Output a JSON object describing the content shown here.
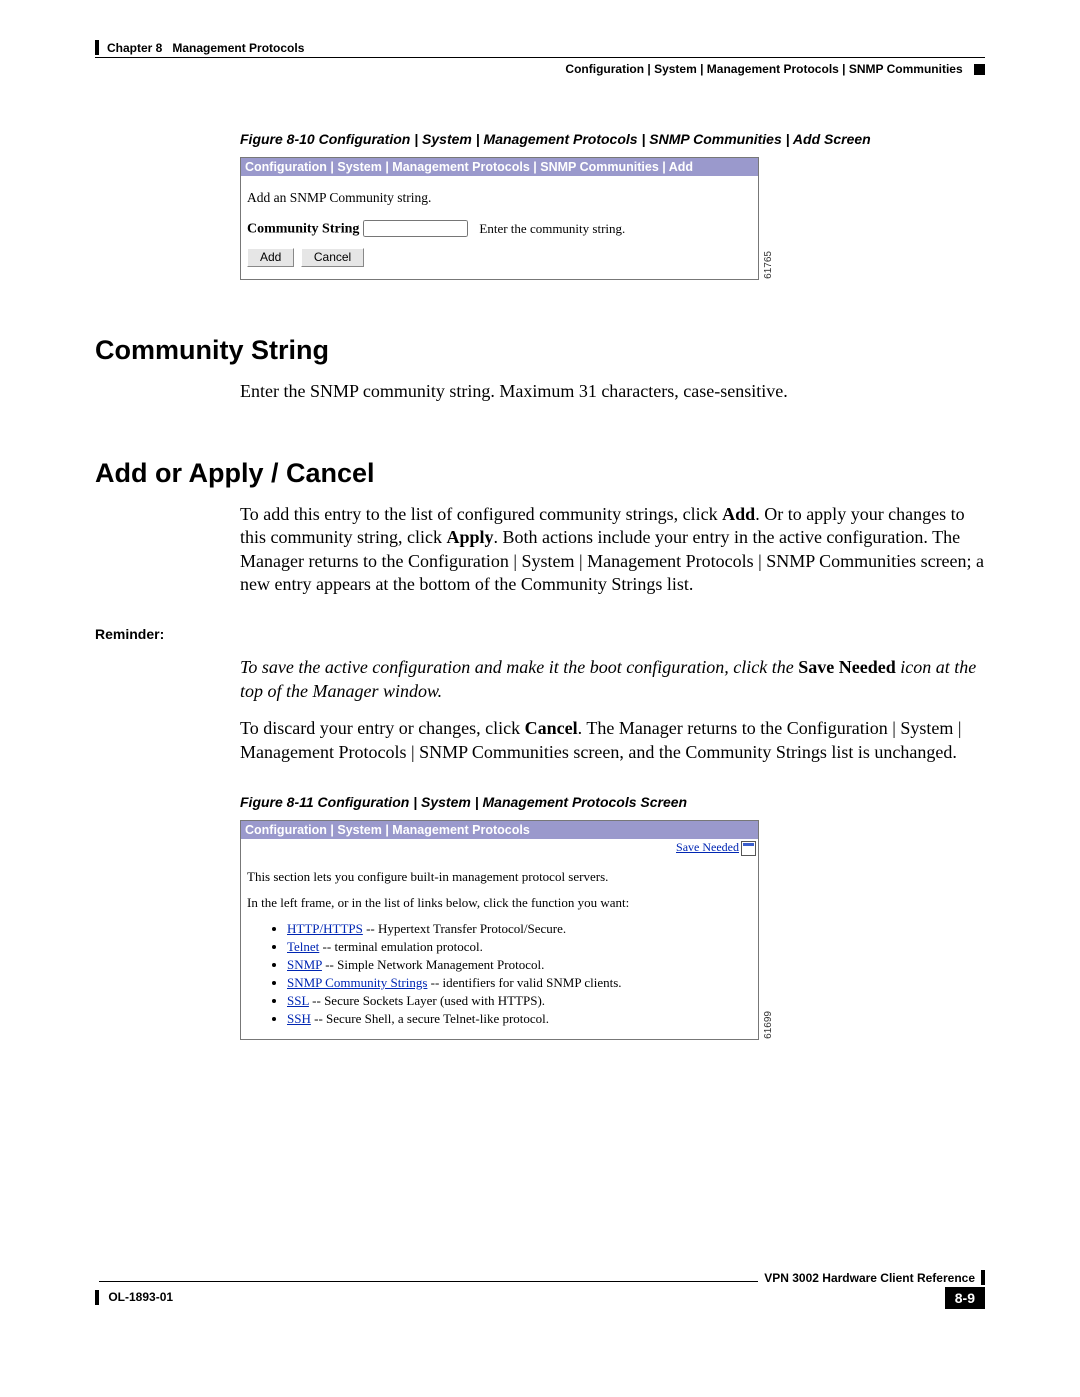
{
  "header": {
    "chapter": "Chapter 8",
    "title": "Management Protocols",
    "breadcrumb": "Configuration | System | Management Protocols | SNMP Communities"
  },
  "fig10": {
    "caption": "Figure 8-10    Configuration | System | Management Protocols | SNMP Communities | Add Screen",
    "titlebar": "Configuration | System | Management Protocols | SNMP Communities | Add",
    "intro": "Add an SNMP Community string.",
    "label": "Community String",
    "hint": "Enter the community string.",
    "add_btn": "Add",
    "cancel_btn": "Cancel",
    "code": "61765"
  },
  "section1": {
    "heading": "Community String",
    "body": "Enter the SNMP community string. Maximum 31 characters, case-sensitive."
  },
  "section2": {
    "heading": "Add or Apply / Cancel",
    "body_p1a": "To add this entry to the list of configured community strings, click ",
    "body_p1b": "Add",
    "body_p1c": ". Or to apply your changes to this community string, click ",
    "body_p1d": "Apply",
    "body_p1e": ". Both actions include your entry in the active configuration. The Manager returns to the Configuration | System | Management Protocols | SNMP Communities screen; a new entry appears at the bottom of the Community Strings list."
  },
  "reminder": {
    "label": "Reminder:",
    "p1a": "To save the active configuration and make it the boot configuration, click the ",
    "p1b": "Save Needed",
    "p1c": " icon at the top of the Manager window.",
    "p2a": "To discard your entry or changes, click ",
    "p2b": "Cancel",
    "p2c": ". The Manager returns to the Configuration | System | Management Protocols | SNMP Communities screen, and the Community Strings list is unchanged."
  },
  "fig11": {
    "caption": "Figure 8-11    Configuration | System | Management Protocols Screen",
    "titlebar": "Configuration | System | Management Protocols",
    "save_needed": "Save Needed",
    "intro": "This section lets you configure built-in management protocol servers.",
    "instr": "In the left frame, or in the list of links below, click the function you want:",
    "items": [
      {
        "link": "HTTP/HTTPS",
        "desc": " -- Hypertext Transfer Protocol/Secure."
      },
      {
        "link": "Telnet",
        "desc": " -- terminal emulation protocol."
      },
      {
        "link": "SNMP",
        "desc": " -- Simple Network Management Protocol."
      },
      {
        "link": "SNMP Community Strings",
        "desc": " -- identifiers for valid SNMP clients."
      },
      {
        "link": "SSL",
        "desc": " -- Secure Sockets Layer (used with HTTPS)."
      },
      {
        "link": "SSH",
        "desc": " -- Secure Shell, a secure Telnet-like protocol."
      }
    ],
    "code": "61699"
  },
  "footer": {
    "doc_title": "VPN 3002 Hardware Client Reference",
    "doc_id": "OL-1893-01",
    "pagenum": "8-9"
  }
}
